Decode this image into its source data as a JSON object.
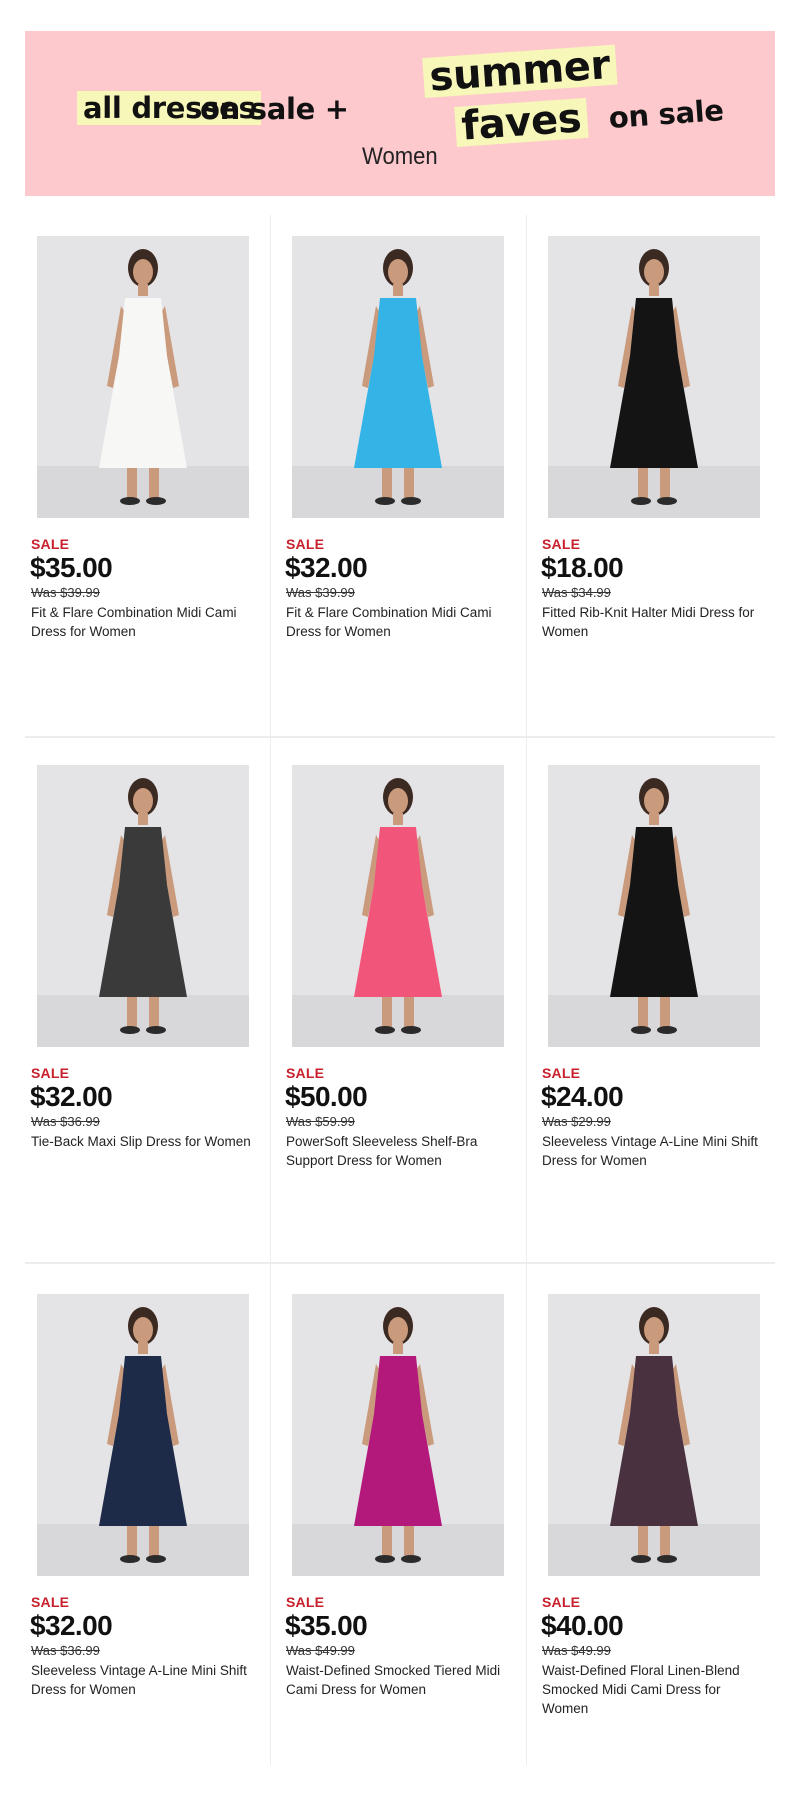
{
  "banner": {
    "part1": "all dresses",
    "part2": "on sale +",
    "part3": "summer",
    "part4": "faves",
    "part5": "on sale",
    "subtitle": "Women",
    "background": "#fdc9cd",
    "highlight": "#f6f7b8"
  },
  "sale_color": "#c8202c",
  "products": [
    {
      "badge": "SALE",
      "price": "$35.00",
      "was": "Was $39.99",
      "name": "Fit & Flare Combination Midi Cami Dress for Women",
      "dress_color": "#f7f7f5"
    },
    {
      "badge": "SALE",
      "price": "$32.00",
      "was": "Was $39.99",
      "name": "Fit & Flare Combination Midi Cami Dress for Women",
      "dress_color": "#33b3e6"
    },
    {
      "badge": "SALE",
      "price": "$18.00",
      "was": "Was $34.99",
      "name": "Fitted Rib-Knit Halter Midi Dress for Women",
      "dress_color": "#141414"
    },
    {
      "badge": "SALE",
      "price": "$32.00",
      "was": "Was $36.99",
      "name": "Tie-Back Maxi Slip Dress for Women",
      "dress_color": "#3a3a3a"
    },
    {
      "badge": "SALE",
      "price": "$50.00",
      "was": "Was $59.99",
      "name": "PowerSoft Sleeveless Shelf-Bra Support Dress for Women",
      "dress_color": "#f2557a"
    },
    {
      "badge": "SALE",
      "price": "$24.00",
      "was": "Was $29.99",
      "name": "Sleeveless Vintage A-Line Mini Shift Dress for Women",
      "dress_color": "#141414"
    },
    {
      "badge": "SALE",
      "price": "$32.00",
      "was": "Was $36.99",
      "name": "Sleeveless Vintage A-Line Mini Shift Dress for Women",
      "dress_color": "#1d2a48"
    },
    {
      "badge": "SALE",
      "price": "$35.00",
      "was": "Was $49.99",
      "name": "Waist-Defined Smocked Tiered Midi Cami Dress for Women",
      "dress_color": "#b3197a"
    },
    {
      "badge": "SALE",
      "price": "$40.00",
      "was": "Was $49.99",
      "name": "Waist-Defined Floral Linen-Blend Smocked Midi Cami Dress for Women",
      "dress_color": "#4a3140"
    }
  ]
}
